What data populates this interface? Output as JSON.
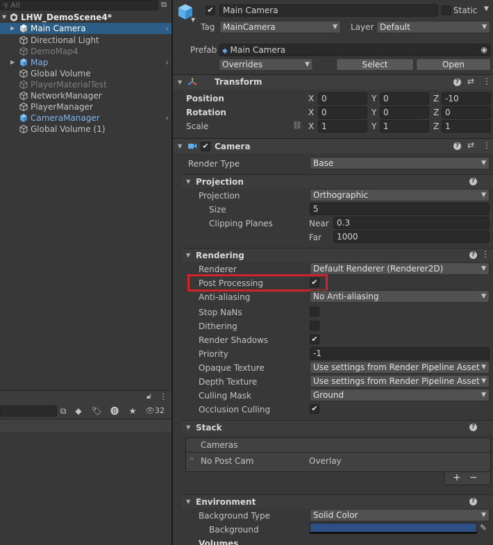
{
  "hierarchy": {
    "search_placeholder": "All",
    "scene": "LHW_DemoScene4*",
    "items": [
      {
        "label": "Main Camera",
        "selected": true,
        "expandable": true
      },
      {
        "label": "Directional Light"
      },
      {
        "label": "DemoMap4",
        "disabled": true
      },
      {
        "label": "Map",
        "expandable": true,
        "prefab": true
      },
      {
        "label": "Global Volume"
      },
      {
        "label": "PlayerMaterialTest",
        "disabled": true
      },
      {
        "label": "NetworkManager"
      },
      {
        "label": "PlayerManager"
      },
      {
        "label": "CameraManager",
        "prefab": true
      },
      {
        "label": "Global Volume (1)"
      }
    ]
  },
  "project": {
    "count": "32"
  },
  "inspector": {
    "object_name": "Main Camera",
    "static_label": "Static",
    "tag_label": "Tag",
    "tag_value": "MainCamera",
    "layer_label": "Layer",
    "layer_value": "Default",
    "prefab_label": "Prefab",
    "prefab_value": "Main Camera",
    "overrides_label": "Overrides",
    "select_label": "Select",
    "open_label": "Open",
    "transform": {
      "title": "Transform",
      "position_label": "Position",
      "rotation_label": "Rotation",
      "scale_label": "Scale",
      "position": {
        "x": "0",
        "y": "0",
        "z": "-10"
      },
      "rotation": {
        "x": "0",
        "y": "0",
        "z": "0"
      },
      "scale": {
        "x": "1",
        "y": "1",
        "z": "1"
      },
      "axis_x": "X",
      "axis_y": "Y",
      "axis_z": "Z"
    },
    "camera": {
      "title": "Camera",
      "render_type_label": "Render Type",
      "render_type_value": "Base",
      "projection_section": "Projection",
      "projection_label": "Projection",
      "projection_value": "Orthographic",
      "size_label": "Size",
      "size_value": "5",
      "clipping_label": "Clipping Planes",
      "near_label": "Near",
      "near_value": "0.3",
      "far_label": "Far",
      "far_value": "1000",
      "rendering_section": "Rendering",
      "renderer_label": "Renderer",
      "renderer_value": "Default Renderer (Renderer2D)",
      "post_processing_label": "Post Processing",
      "anti_aliasing_label": "Anti-aliasing",
      "anti_aliasing_value": "No Anti-aliasing",
      "stop_nans_label": "Stop NaNs",
      "dithering_label": "Dithering",
      "render_shadows_label": "Render Shadows",
      "priority_label": "Priority",
      "priority_value": "-1",
      "opaque_texture_label": "Opaque Texture",
      "opaque_texture_value": "Use settings from Render Pipeline Asset",
      "depth_texture_label": "Depth Texture",
      "depth_texture_value": "Use settings from Render Pipeline Asset",
      "culling_mask_label": "Culling Mask",
      "culling_mask_value": "Ground",
      "occlusion_culling_label": "Occlusion Culling",
      "stack_section": "Stack",
      "cameras_label": "Cameras",
      "stack_item_name": "No Post Cam",
      "stack_item_type": "Overlay",
      "environment_section": "Environment",
      "background_type_label": "Background Type",
      "background_type_value": "Solid Color",
      "background_label": "Background",
      "background_color": "#2e4f86",
      "volumes_label": "Volumes"
    }
  }
}
